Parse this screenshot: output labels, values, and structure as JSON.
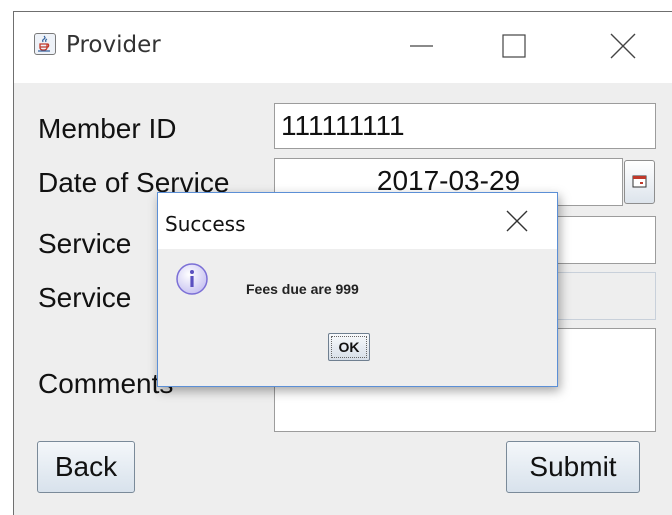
{
  "window": {
    "title": "Provider",
    "icons": {
      "app": "java-coffee-icon",
      "minimize": "minimize-icon",
      "maximize": "maximize-icon",
      "close": "close-icon"
    }
  },
  "form": {
    "member_id_label": "Member ID",
    "member_id_value": "111111111",
    "date_label": "Date of Service",
    "date_value": "2017-03-29",
    "date_picker_icon": "calendar-icon",
    "service_code_label": "Service",
    "service_name_label": "Service",
    "comments_label": "Comments",
    "back_label": "Back",
    "submit_label": "Submit"
  },
  "dialog": {
    "title": "Success",
    "message": "Fees due are 999",
    "ok_label": "OK",
    "icon": "info-icon",
    "close_icon": "close-icon"
  },
  "colors": {
    "window_bg": "#eeeeee",
    "dialog_border": "#5b8fd6",
    "info_icon": "#7b6fd6"
  }
}
